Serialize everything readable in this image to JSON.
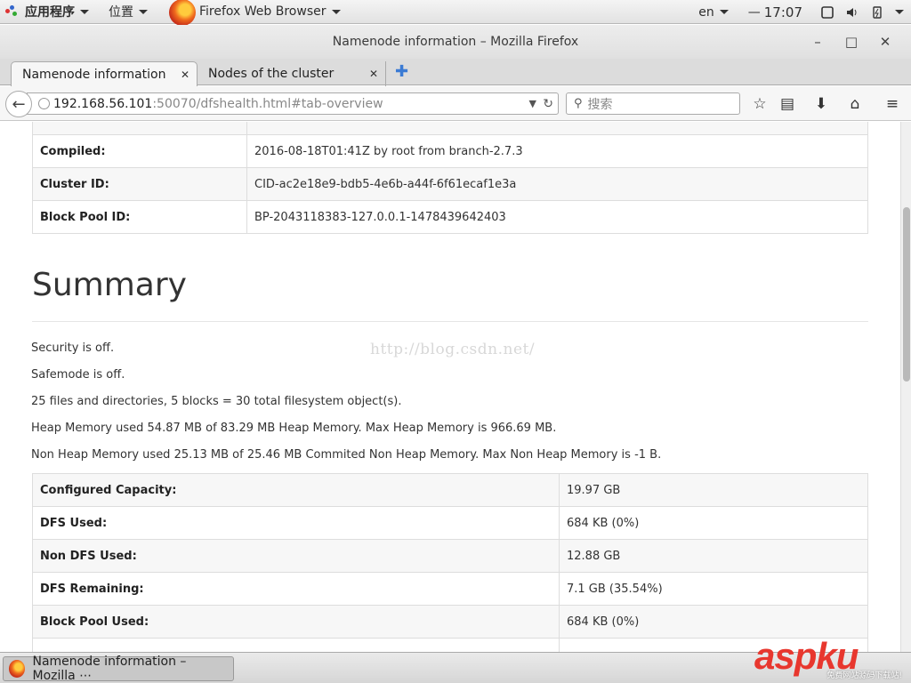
{
  "panel": {
    "apps_label": "应用程序",
    "places_label": "位置",
    "firefox_label": "Firefox Web Browser",
    "lang": "en",
    "clock": "17:07"
  },
  "window": {
    "title": "Namenode information – Mozilla Firefox",
    "minimize": "–",
    "maximize": "□",
    "close": "✕"
  },
  "tabs": [
    {
      "label": "Namenode information"
    },
    {
      "label": "Nodes of the cluster"
    }
  ],
  "navbar": {
    "url_host": "192.168.56.101",
    "url_path": ":50070/dfshealth.html#tab-overview",
    "search_placeholder": "搜索"
  },
  "overview_table": [
    {
      "key": "Compiled:",
      "value": "2016-08-18T01:41Z by root from branch-2.7.3"
    },
    {
      "key": "Cluster ID:",
      "value": "CID-ac2e18e9-bdb5-4e6b-a44f-6f61ecaf1e3a"
    },
    {
      "key": "Block Pool ID:",
      "value": "BP-2043118383-127.0.0.1-1478439642403"
    }
  ],
  "summary": {
    "heading": "Summary",
    "lines": [
      "Security is off.",
      "Safemode is off.",
      "25 files and directories, 5 blocks = 30 total filesystem object(s).",
      "Heap Memory used 54.87 MB of 83.29 MB Heap Memory. Max Heap Memory is 966.69 MB.",
      "Non Heap Memory used 25.13 MB of 25.46 MB Commited Non Heap Memory. Max Non Heap Memory is -1 B."
    ],
    "watermark": "http://blog.csdn.net/",
    "table": [
      {
        "key": "Configured Capacity:",
        "value": "19.97 GB"
      },
      {
        "key": "DFS Used:",
        "value": "684 KB (0%)"
      },
      {
        "key": "Non DFS Used:",
        "value": "12.88 GB"
      },
      {
        "key": "DFS Remaining:",
        "value": "7.1 GB (35.54%)"
      },
      {
        "key": "Block Pool Used:",
        "value": "684 KB (0%)"
      }
    ]
  },
  "taskbar": {
    "window_label": "Namenode information – Mozilla ⋯"
  },
  "site_logo": {
    "text": "aspku",
    "sub": "免费网站源码下载站!"
  }
}
